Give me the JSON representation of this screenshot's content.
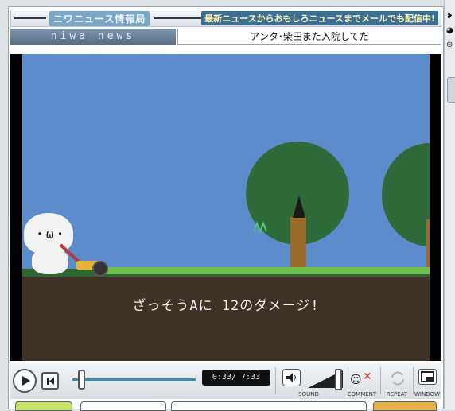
{
  "banner": {
    "site_title": "ニワニュース情報局",
    "promo": "最新ニュースからおもしろニュースまでメールでも配信中!"
  },
  "brand": {
    "logo_text": "niwa news"
  },
  "headline": {
    "text": "アンタ･柴田また入院してた"
  },
  "video": {
    "subtitle": "ざっそうAに 12のダメージ!",
    "scene_colors": {
      "sky": "#5d8ccc",
      "grass": "#6fbf4a",
      "ground": "#3f3226",
      "tree": "#2f6a3b"
    }
  },
  "player": {
    "time_display": "0:33/ 7:33",
    "progress": 0.073,
    "volume": 1.0,
    "labels": {
      "sound": "SOUND",
      "comment": "COMMENT",
      "repeat": "REPEAT",
      "window": "WINDOW"
    }
  },
  "right_strip": {
    "glyphs": [
      "❥",
      "◕",
      "⊜"
    ]
  },
  "colors": {
    "accent": "#3b8db5",
    "frame_border": "#9aa3ad"
  }
}
